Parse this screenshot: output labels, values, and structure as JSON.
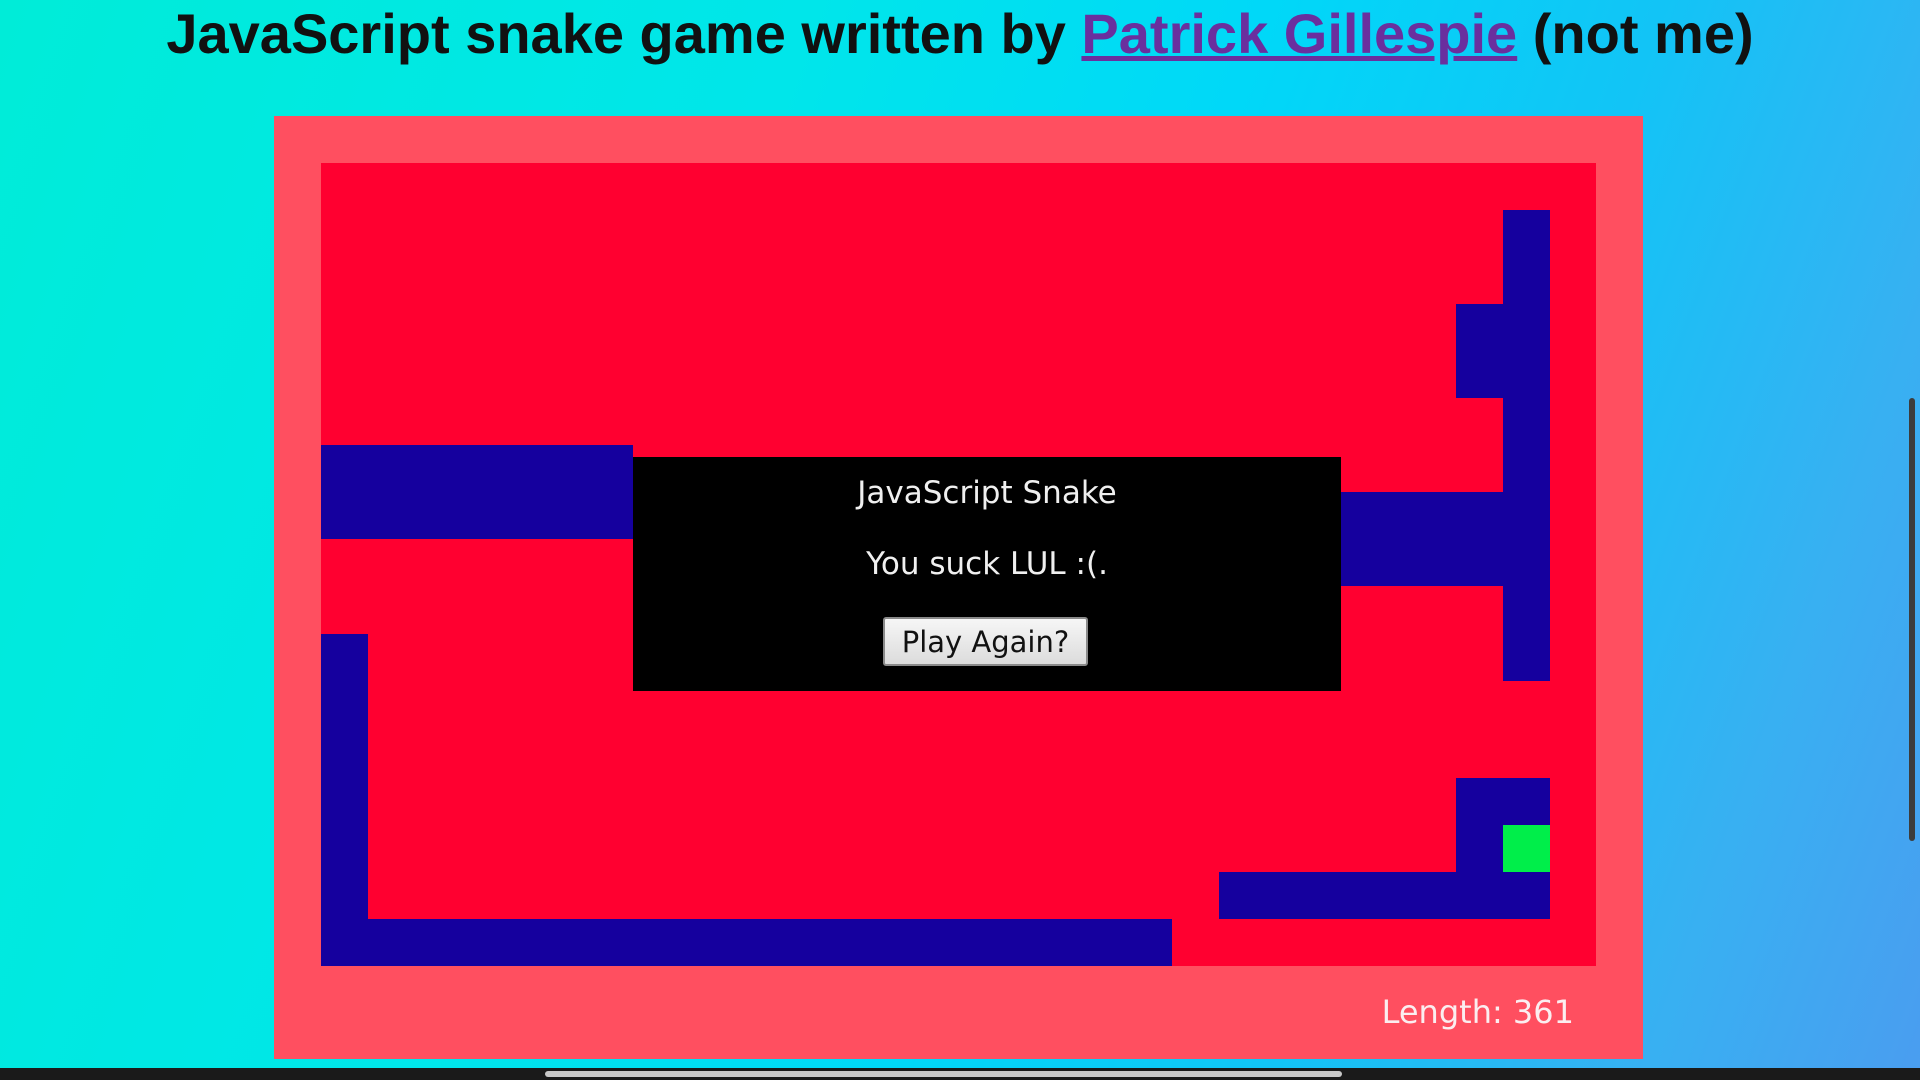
{
  "header": {
    "prefix": "JavaScript snake game written by ",
    "author_link": "Patrick Gillespie",
    "suffix": " (not me)"
  },
  "game": {
    "board_color": "#ff0030",
    "frame_color": "#ff4f60",
    "snake_color": "#15009e",
    "food_color": "#00ee4a",
    "length_label": "Length: 361"
  },
  "dialog": {
    "title": "JavaScript Snake",
    "message": "You suck LUL :(.",
    "button_label": "Play Again?"
  }
}
